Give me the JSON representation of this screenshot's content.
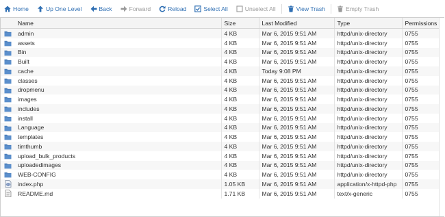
{
  "toolbar": {
    "home": "Home",
    "up": "Up One Level",
    "back": "Back",
    "forward": "Forward",
    "reload": "Reload",
    "select_all": "Select All",
    "unselect_all": "Unselect All",
    "view_trash": "View Trash",
    "empty_trash": "Empty Trash"
  },
  "columns": {
    "name": "Name",
    "size": "Size",
    "modified": "Last Modified",
    "type": "Type",
    "permissions": "Permissions"
  },
  "files": [
    {
      "icon": "folder-icon",
      "name": "admin",
      "size": "4 KB",
      "modified": "Mar 6, 2015 9:51 AM",
      "type": "httpd/unix-directory",
      "perm": "0755"
    },
    {
      "icon": "folder-icon",
      "name": "assets",
      "size": "4 KB",
      "modified": "Mar 6, 2015 9:51 AM",
      "type": "httpd/unix-directory",
      "perm": "0755"
    },
    {
      "icon": "folder-icon",
      "name": "Bin",
      "size": "4 KB",
      "modified": "Mar 6, 2015 9:51 AM",
      "type": "httpd/unix-directory",
      "perm": "0755"
    },
    {
      "icon": "folder-icon",
      "name": "Built",
      "size": "4 KB",
      "modified": "Mar 6, 2015 9:51 AM",
      "type": "httpd/unix-directory",
      "perm": "0755"
    },
    {
      "icon": "folder-icon",
      "name": "cache",
      "size": "4 KB",
      "modified": "Today 9:08 PM",
      "type": "httpd/unix-directory",
      "perm": "0755"
    },
    {
      "icon": "folder-icon",
      "name": "classes",
      "size": "4 KB",
      "modified": "Mar 6, 2015 9:51 AM",
      "type": "httpd/unix-directory",
      "perm": "0755"
    },
    {
      "icon": "folder-icon",
      "name": "dropmenu",
      "size": "4 KB",
      "modified": "Mar 6, 2015 9:51 AM",
      "type": "httpd/unix-directory",
      "perm": "0755"
    },
    {
      "icon": "folder-icon",
      "name": "images",
      "size": "4 KB",
      "modified": "Mar 6, 2015 9:51 AM",
      "type": "httpd/unix-directory",
      "perm": "0755"
    },
    {
      "icon": "folder-icon",
      "name": "includes",
      "size": "4 KB",
      "modified": "Mar 6, 2015 9:51 AM",
      "type": "httpd/unix-directory",
      "perm": "0755"
    },
    {
      "icon": "folder-icon",
      "name": "install",
      "size": "4 KB",
      "modified": "Mar 6, 2015 9:51 AM",
      "type": "httpd/unix-directory",
      "perm": "0755"
    },
    {
      "icon": "folder-icon",
      "name": "Language",
      "size": "4 KB",
      "modified": "Mar 6, 2015 9:51 AM",
      "type": "httpd/unix-directory",
      "perm": "0755"
    },
    {
      "icon": "folder-icon",
      "name": "templates",
      "size": "4 KB",
      "modified": "Mar 6, 2015 9:51 AM",
      "type": "httpd/unix-directory",
      "perm": "0755"
    },
    {
      "icon": "folder-icon",
      "name": "timthumb",
      "size": "4 KB",
      "modified": "Mar 6, 2015 9:51 AM",
      "type": "httpd/unix-directory",
      "perm": "0755"
    },
    {
      "icon": "folder-icon",
      "name": "upload_bulk_products",
      "size": "4 KB",
      "modified": "Mar 6, 2015 9:51 AM",
      "type": "httpd/unix-directory",
      "perm": "0755"
    },
    {
      "icon": "folder-icon",
      "name": "uploadedimages",
      "size": "4 KB",
      "modified": "Mar 6, 2015 9:51 AM",
      "type": "httpd/unix-directory",
      "perm": "0755"
    },
    {
      "icon": "folder-icon",
      "name": "WEB-CONFIG",
      "size": "4 KB",
      "modified": "Mar 6, 2015 9:51 AM",
      "type": "httpd/unix-directory",
      "perm": "0755"
    },
    {
      "icon": "php-file-icon",
      "name": "index.php",
      "size": "1.05 KB",
      "modified": "Mar 6, 2015 9:51 AM",
      "type": "application/x-httpd-php",
      "perm": "0755"
    },
    {
      "icon": "text-file-icon",
      "name": "README.md",
      "size": "1.71 KB",
      "modified": "Mar 6, 2015 9:51 AM",
      "type": "text/x-generic",
      "perm": "0755"
    }
  ],
  "colors": {
    "accent": "#2f6fb3",
    "disabled": "#9a9a9a",
    "folder": "#4f81bd",
    "row_alt": "#f7f7f7"
  }
}
